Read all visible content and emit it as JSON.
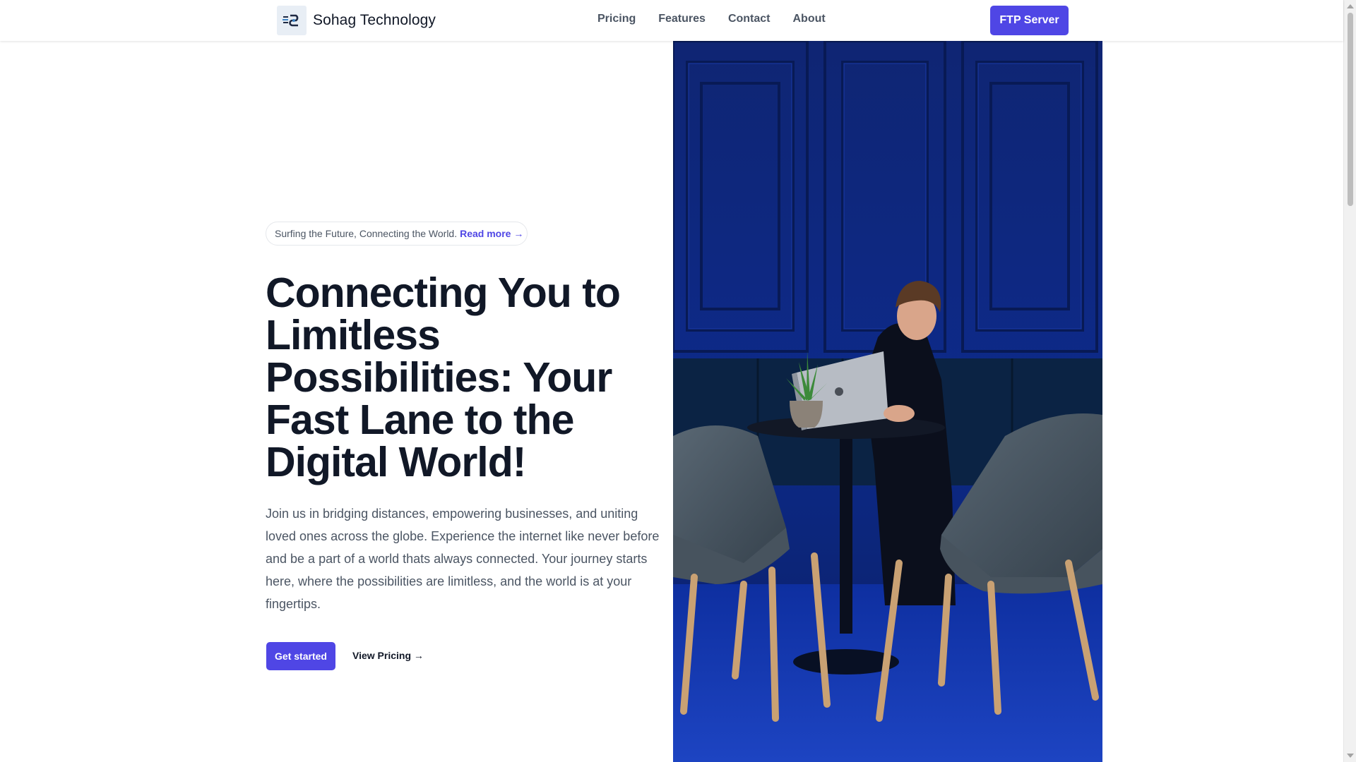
{
  "header": {
    "brand": "Sohag Technology",
    "logo_icon": "sohag-logo-icon",
    "nav": [
      {
        "label": "Pricing"
      },
      {
        "label": "Features"
      },
      {
        "label": "Contact"
      },
      {
        "label": "About"
      }
    ],
    "cta_label": "FTP Server"
  },
  "hero": {
    "pill_text": "Surfing the Future, Connecting the World.",
    "pill_link": "Read more →",
    "headline": "Connecting You to Limitless Possibilities: Your Fast Lane to the Digital World!",
    "lead": "Join us in bridging distances, empowering businesses, and uniting loved ones across the globe. Experience the internet like never before and be a part of a world thats always connected. Your journey starts here, where the possibilities are limitless, and the world is at your fingertips.",
    "primary_cta": "Get started",
    "secondary_cta": "View Pricing →",
    "image_alt_icon": "hero-photo"
  },
  "colors": {
    "accent": "#4f46e5",
    "heading": "#111827",
    "body_text": "#4b5563",
    "hero_wall": "#0d2a8a"
  }
}
